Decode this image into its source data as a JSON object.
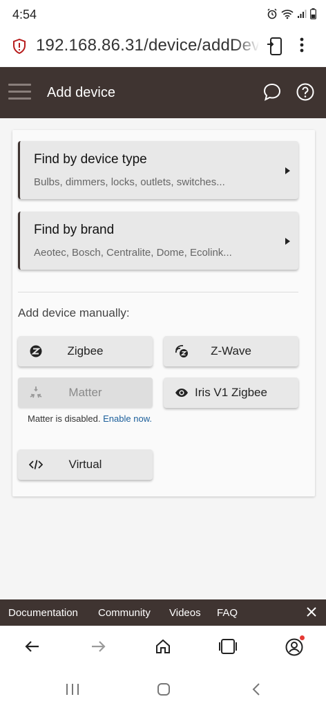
{
  "status_bar": {
    "time": "4:54"
  },
  "browser": {
    "url": "192.168.86.31/device/addDevice"
  },
  "header": {
    "title": "Add device"
  },
  "find_options": [
    {
      "title": "Find by device type",
      "subtitle": "Bulbs, dimmers, locks, outlets, switches..."
    },
    {
      "title": "Find by brand",
      "subtitle": "Aeotec, Bosch, Centralite, Dome, Ecolink..."
    }
  ],
  "manual": {
    "label": "Add device manually:",
    "buttons": {
      "zigbee": "Zigbee",
      "zwave": "Z-Wave",
      "matter": "Matter",
      "iris": "Iris V1 Zigbee",
      "virtual": "Virtual"
    },
    "matter_note": "Matter is disabled.",
    "matter_enable_link": "Enable now."
  },
  "footer_links": [
    "Documentation",
    "Community",
    "Videos",
    "FAQ"
  ],
  "colors": {
    "header_bg": "#3f3431",
    "link": "#1a5e9a"
  }
}
